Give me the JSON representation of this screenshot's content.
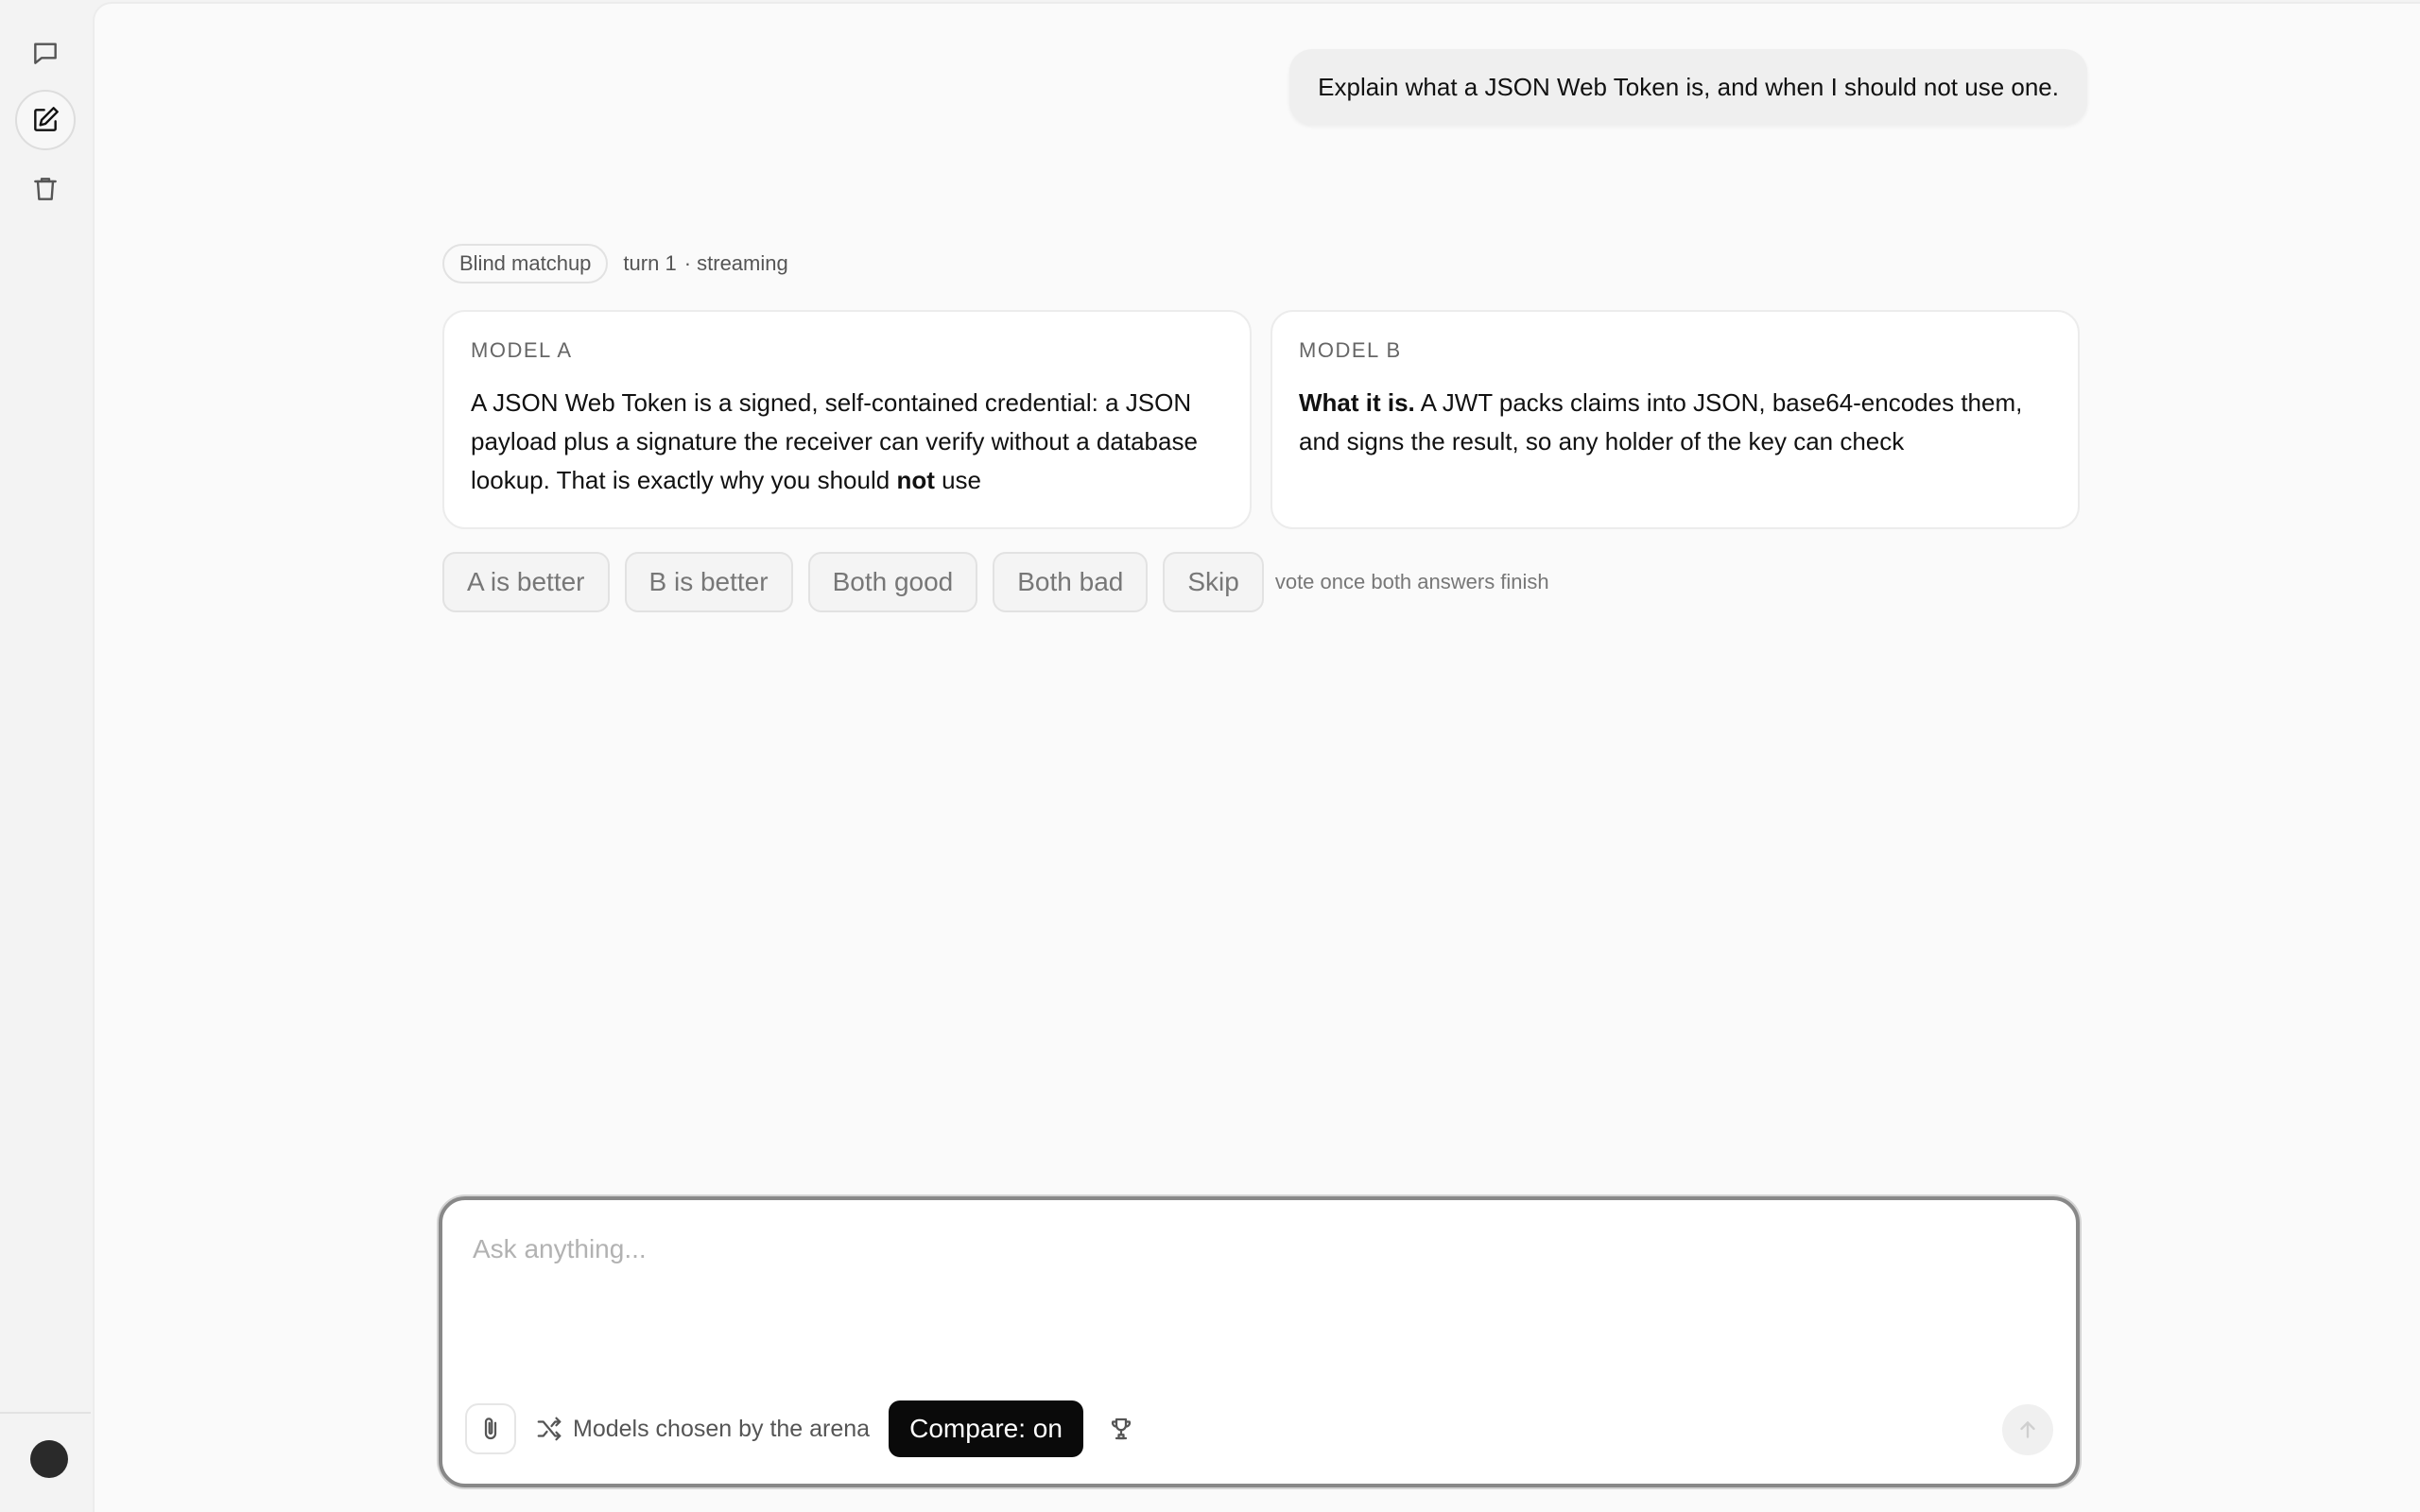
{
  "user_message": "Explain what a JSON Web Token is, and when I should not use one.",
  "matchup": {
    "badge": "Blind matchup",
    "turn": "turn 1",
    "status": "· streaming"
  },
  "model_a": {
    "label": "MODEL A",
    "text_before": "A JSON Web Token is a signed, self-contained credential: a JSON payload plus a signature the receiver can verify without a database lookup. That is exactly why you should ",
    "text_bold": "not",
    "text_after": " use"
  },
  "model_b": {
    "label": "MODEL B",
    "text_bold": "What it is.",
    "text_after": " A JWT packs claims into JSON, base64-encodes them, and signs the result, so any holder of the key can check"
  },
  "vote": {
    "a_better": "A is better",
    "b_better": "B is better",
    "both_good": "Both good",
    "both_bad": "Both bad",
    "skip": "Skip",
    "hint": "vote once both answers finish"
  },
  "composer": {
    "placeholder": "Ask anything...",
    "model_selector": "Models chosen by the arena",
    "compare_toggle": "Compare: on"
  },
  "icons": {
    "rail": [
      "chat-icon",
      "new-chat-icon",
      "trash-icon"
    ],
    "toolbar": [
      "paperclip-icon",
      "shuffle-icon",
      "trophy-icon",
      "send-arrow-icon"
    ]
  }
}
